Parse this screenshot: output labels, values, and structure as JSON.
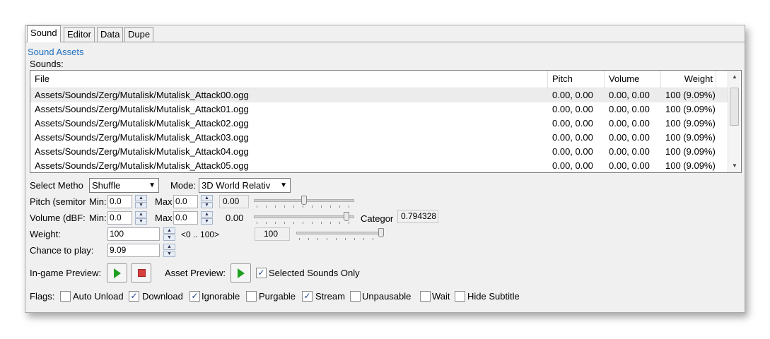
{
  "tabs": [
    "Sound",
    "Editor",
    "Data",
    "Dupe"
  ],
  "section_link": "Sound Assets",
  "sounds_label": "Sounds:",
  "list": {
    "columns": [
      "File",
      "Pitch",
      "Volume",
      "Weight"
    ],
    "rows": [
      [
        "Assets/Sounds/Zerg/Mutalisk/Mutalisk_Attack00.ogg",
        "0.00, 0.00",
        "0.00, 0.00",
        "100 (9.09%)"
      ],
      [
        "Assets/Sounds/Zerg/Mutalisk/Mutalisk_Attack01.ogg",
        "0.00, 0.00",
        "0.00, 0.00",
        "100 (9.09%)"
      ],
      [
        "Assets/Sounds/Zerg/Mutalisk/Mutalisk_Attack02.ogg",
        "0.00, 0.00",
        "0.00, 0.00",
        "100 (9.09%)"
      ],
      [
        "Assets/Sounds/Zerg/Mutalisk/Mutalisk_Attack03.ogg",
        "0.00, 0.00",
        "0.00, 0.00",
        "100 (9.09%)"
      ],
      [
        "Assets/Sounds/Zerg/Mutalisk/Mutalisk_Attack04.ogg",
        "0.00, 0.00",
        "0.00, 0.00",
        "100 (9.09%)"
      ],
      [
        "Assets/Sounds/Zerg/Mutalisk/Mutalisk_Attack05.ogg",
        "0.00, 0.00",
        "0.00, 0.00",
        "100 (9.09%)"
      ]
    ]
  },
  "select_method": {
    "label": "Select Metho",
    "value": "Shuffle"
  },
  "mode": {
    "label": "Mode:",
    "value": "3D World Relativ"
  },
  "pitch": {
    "label": "Pitch (semitor",
    "min_label": "Min:",
    "min": "0.0",
    "max_label": "Max",
    "max": "0.0",
    "display": "0.00",
    "slider_level": 0.5
  },
  "volume": {
    "label": "Volume (dBF:",
    "min_label": "Min:",
    "min": "0.0",
    "max_label": "Max",
    "max": "0.0",
    "display": "0.00",
    "slider_level": 0.95,
    "category_label": "Categor",
    "category_value": "0.794328"
  },
  "weight": {
    "label": "Weight:",
    "value": "100",
    "range": "<0 .. 100>",
    "display": "100",
    "slider_level": 1.0
  },
  "chance": {
    "label": "Chance to play:",
    "value": "9.09"
  },
  "ingame_preview_label": "In-game Preview:",
  "asset_preview_label": "Asset Preview:",
  "selected_only": {
    "label": "Selected Sounds Only",
    "checked": true
  },
  "flags": {
    "label": "Flags:",
    "items": [
      {
        "label": "Auto Unload",
        "checked": false
      },
      {
        "label": "Download",
        "checked": true
      },
      {
        "label": "Ignorable",
        "checked": true
      },
      {
        "label": "Purgable",
        "checked": false
      },
      {
        "label": "Stream",
        "checked": true
      },
      {
        "label": "Unpausable",
        "checked": false
      },
      {
        "label": "Wait",
        "checked": false
      },
      {
        "label": "Hide Subtitle",
        "checked": false
      }
    ]
  }
}
